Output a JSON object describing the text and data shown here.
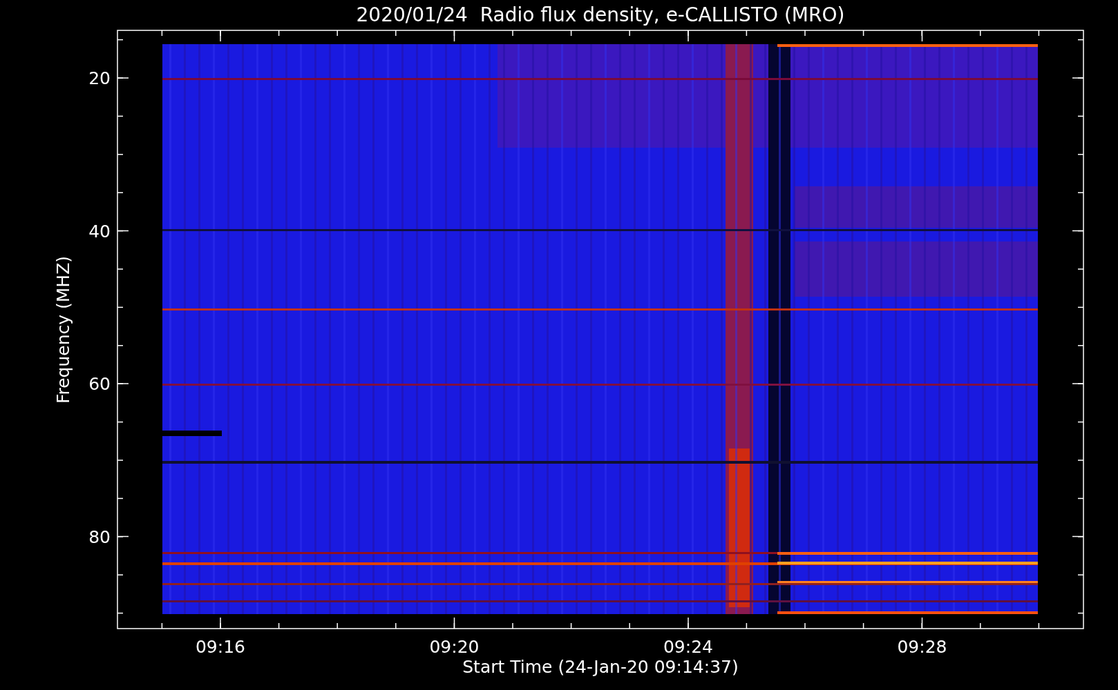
{
  "title": "2020/01/24  Radio flux density, e-CALLISTO (MRO)",
  "axes": {
    "xlabel": "Start Time (24-Jan-20 09:14:37)",
    "ylabel": "Frequency (MHZ)",
    "xticks": [
      "09:16",
      "09:20",
      "09:24",
      "09:28"
    ],
    "yticks": [
      "20",
      "40",
      "60",
      "80"
    ]
  }
}
